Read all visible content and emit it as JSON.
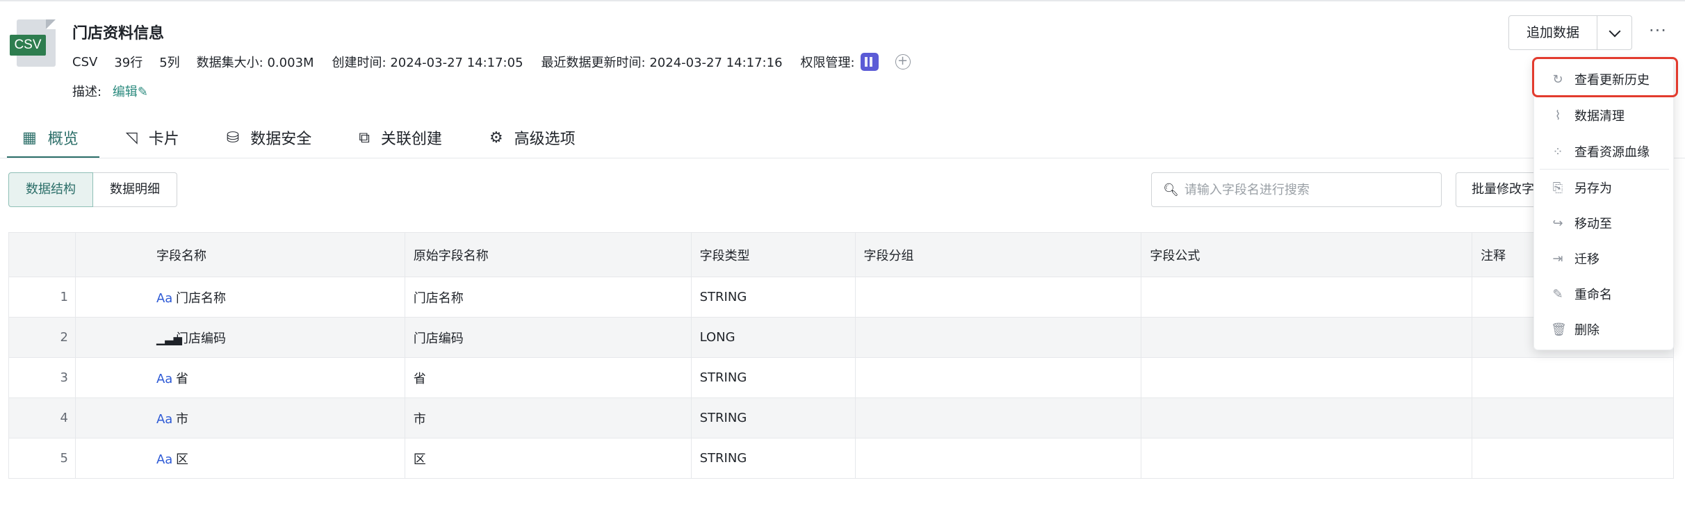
{
  "header": {
    "file_tag": "CSV",
    "title": "门店资料信息",
    "meta": {
      "format": "CSV",
      "rows": "39行",
      "cols": "5列",
      "size_label": "数据集大小:",
      "size_value": "0.003M",
      "created_label": "创建时间:",
      "created_value": "2024-03-27 14:17:05",
      "updated_label": "最近数据更新时间:",
      "updated_value": "2024-03-27 14:17:16",
      "perm_label": "权限管理:"
    },
    "desc_label": "描述:",
    "edit_label": "编辑",
    "append_button": "追加数据"
  },
  "tabs": [
    {
      "label": "概览",
      "icon": "table-icon"
    },
    {
      "label": "卡片",
      "icon": "chart-card-icon"
    },
    {
      "label": "数据安全",
      "icon": "database-lock-icon"
    },
    {
      "label": "关联创建",
      "icon": "link-create-icon"
    },
    {
      "label": "高级选项",
      "icon": "gear-icon"
    }
  ],
  "segment": [
    "数据结构",
    "数据明细"
  ],
  "search": {
    "placeholder": "请输入字段名进行搜索"
  },
  "batch_button": "批量修改字",
  "table": {
    "headers": [
      "",
      "字段名称",
      "原始字段名称",
      "字段类型",
      "字段分组",
      "字段公式",
      "注释"
    ],
    "rows": [
      {
        "idx": "1",
        "type_icon": "Aa",
        "name": "门店名称",
        "orig": "门店名称",
        "type": "STRING",
        "group": "",
        "formula": "",
        "note": ""
      },
      {
        "idx": "2",
        "type_icon": "numeric-bars",
        "name": "门店编码",
        "orig": "门店编码",
        "type": "LONG",
        "group": "",
        "formula": "",
        "note": ""
      },
      {
        "idx": "3",
        "type_icon": "Aa",
        "name": "省",
        "orig": "省",
        "type": "STRING",
        "group": "",
        "formula": "",
        "note": ""
      },
      {
        "idx": "4",
        "type_icon": "Aa",
        "name": "市",
        "orig": "市",
        "type": "STRING",
        "group": "",
        "formula": "",
        "note": ""
      },
      {
        "idx": "5",
        "type_icon": "Aa",
        "name": "区",
        "orig": "区",
        "type": "STRING",
        "group": "",
        "formula": "",
        "note": ""
      }
    ]
  },
  "menu": {
    "items": [
      {
        "label": "查看更新历史",
        "icon": "history-icon"
      },
      {
        "label": "数据清理",
        "icon": "broom-icon"
      },
      {
        "label": "查看资源血缘",
        "icon": "lineage-icon"
      },
      {
        "label": "另存为",
        "icon": "save-as-icon"
      },
      {
        "label": "移动至",
        "icon": "move-icon"
      },
      {
        "label": "迁移",
        "icon": "migrate-icon"
      },
      {
        "label": "重命名",
        "icon": "rename-icon"
      },
      {
        "label": "删除",
        "icon": "trash-icon"
      }
    ]
  },
  "colors": {
    "accent": "#2b6e68",
    "highlight": "#e23b2e",
    "csv_tag": "#2e7d4f",
    "string_icon": "#2f5bd6"
  }
}
